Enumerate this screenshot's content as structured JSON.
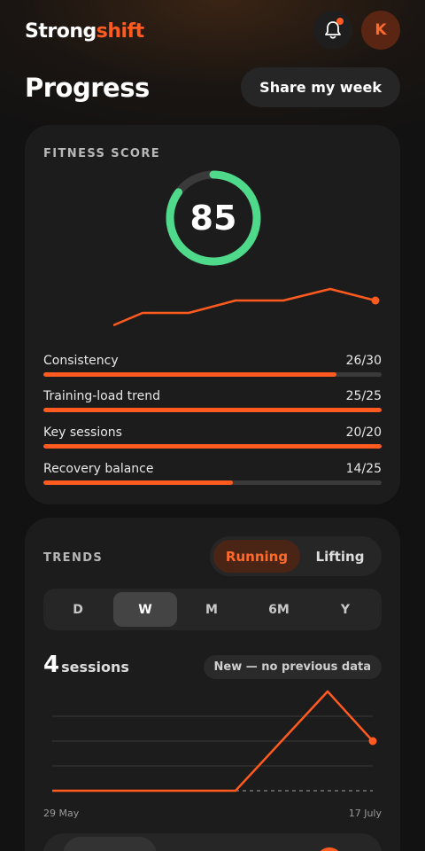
{
  "app": {
    "name_part1": "Strong",
    "name_part2": "shift",
    "avatar_initial": "K",
    "brand_color": "#ff5a1f"
  },
  "header": {
    "title": "Progress",
    "share_label": "Share my week",
    "notification_icon": "bell-icon"
  },
  "fitness": {
    "label": "FITNESS SCORE",
    "score": "85",
    "score_value": 85,
    "score_color": "#4fd98a",
    "metrics": [
      {
        "label": "Consistency",
        "value": "26/30",
        "fraction": 0.8667
      },
      {
        "label": "Training-load trend",
        "value": "25/25",
        "fraction": 1.0
      },
      {
        "label": "Key sessions",
        "value": "20/20",
        "fraction": 1.0
      },
      {
        "label": "Recovery balance",
        "value": "14/25",
        "fraction": 0.56
      }
    ]
  },
  "trends": {
    "label": "TRENDS",
    "types": [
      "Running",
      "Lifting"
    ],
    "active_type": "Running",
    "periods": [
      "D",
      "W",
      "M",
      "6M",
      "Y"
    ],
    "active_period": "W",
    "sessions_count": "4",
    "sessions_unit": "sessions",
    "comparison_badge": "New — no previous data",
    "x_start": "29 May",
    "x_end": "17 July"
  }
}
